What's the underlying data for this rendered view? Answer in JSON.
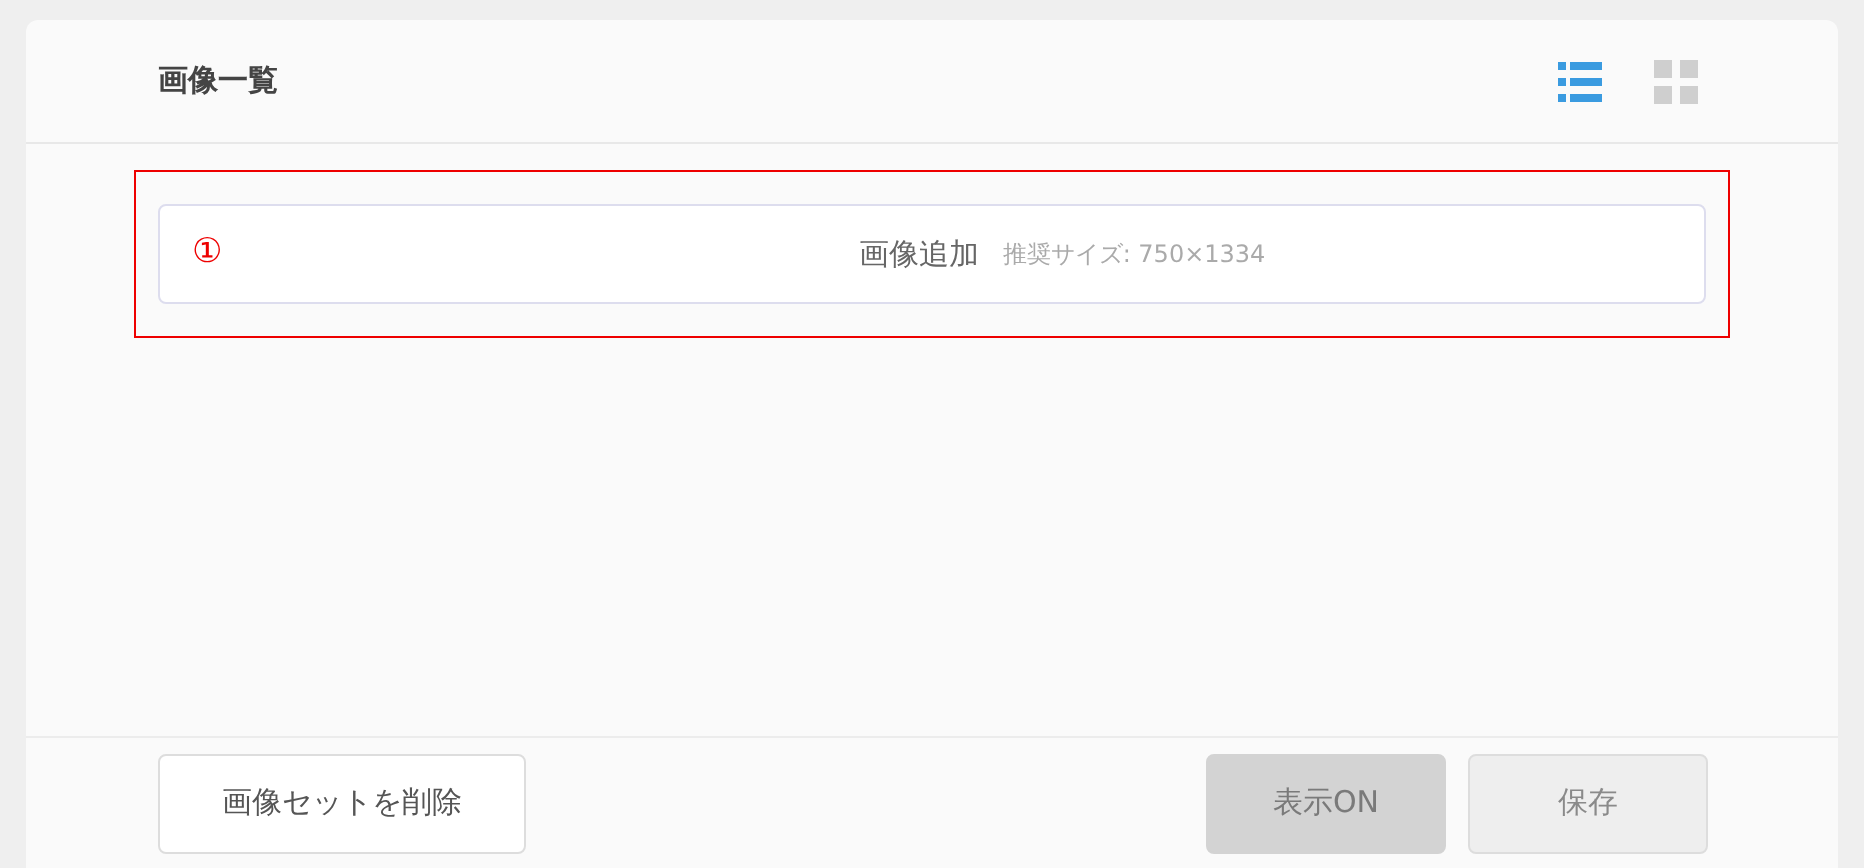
{
  "header": {
    "title": "画像一覧",
    "view_modes": [
      {
        "kind": "list",
        "selected": true
      },
      {
        "kind": "grid",
        "selected": false
      }
    ]
  },
  "annotation": {
    "marker": "①"
  },
  "upload": {
    "label": "画像追加",
    "hint": "推奨サイズ: 750×1334"
  },
  "footer": {
    "buttons": [
      {
        "label": "画像セットを削除",
        "kind": "outline",
        "disabled": false
      },
      {
        "label": "表示ON",
        "kind": "filled",
        "disabled": true
      },
      {
        "label": "保存",
        "kind": "outline",
        "disabled": true
      }
    ]
  }
}
